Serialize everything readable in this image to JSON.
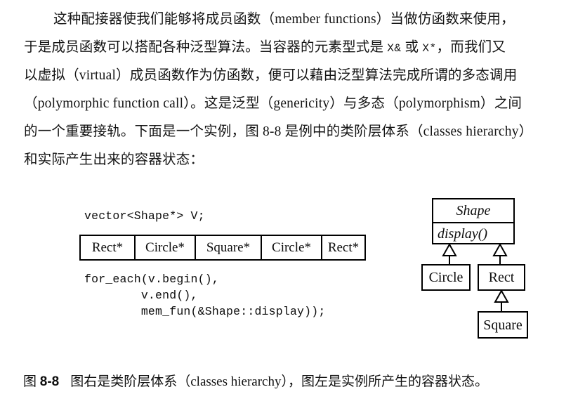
{
  "prose": {
    "lines": [
      "这种配接器使我们能够将成员函数（member functions）当做仿函数来使用，",
      "于是成员函数可以搭配各种泛型算法。当容器的元素型式是 ",
      "以虚拟（virtual）成员函数作为仿函数，便可以藉由泛型算法完成所谓的多态调用",
      "（polymorphic function call）。这是泛型（genericity）与多态（polymorphism）之间",
      "的一个重要接轨。下面是一个实例，图 8-8 是例中的类阶层体系（classes hierarchy）",
      "和实际产生出来的容器状态："
    ],
    "line2_mono_a": "X&",
    "line2_mid": " 或 ",
    "line2_mono_b": "X*",
    "line2_tail": "，而我们又"
  },
  "figure": {
    "code_decl": "vector<Shape*> V;",
    "code_foreach": "for_each(v.begin(),\n        v.end(),\n        mem_fun(&Shape::display));",
    "vector_cells": [
      "Rect*",
      "Circle*",
      "Square*",
      "Circle*",
      "Rect*"
    ],
    "uml": {
      "base_class": "Shape",
      "base_method": "display()",
      "derived_left": "Circle",
      "derived_right": "Rect",
      "derived_leaf": "Square"
    }
  },
  "caption": {
    "label": "图",
    "number": "8-8",
    "text": "图右是类阶层体系（classes hierarchy），图左是实例所产生的容器状态。"
  }
}
